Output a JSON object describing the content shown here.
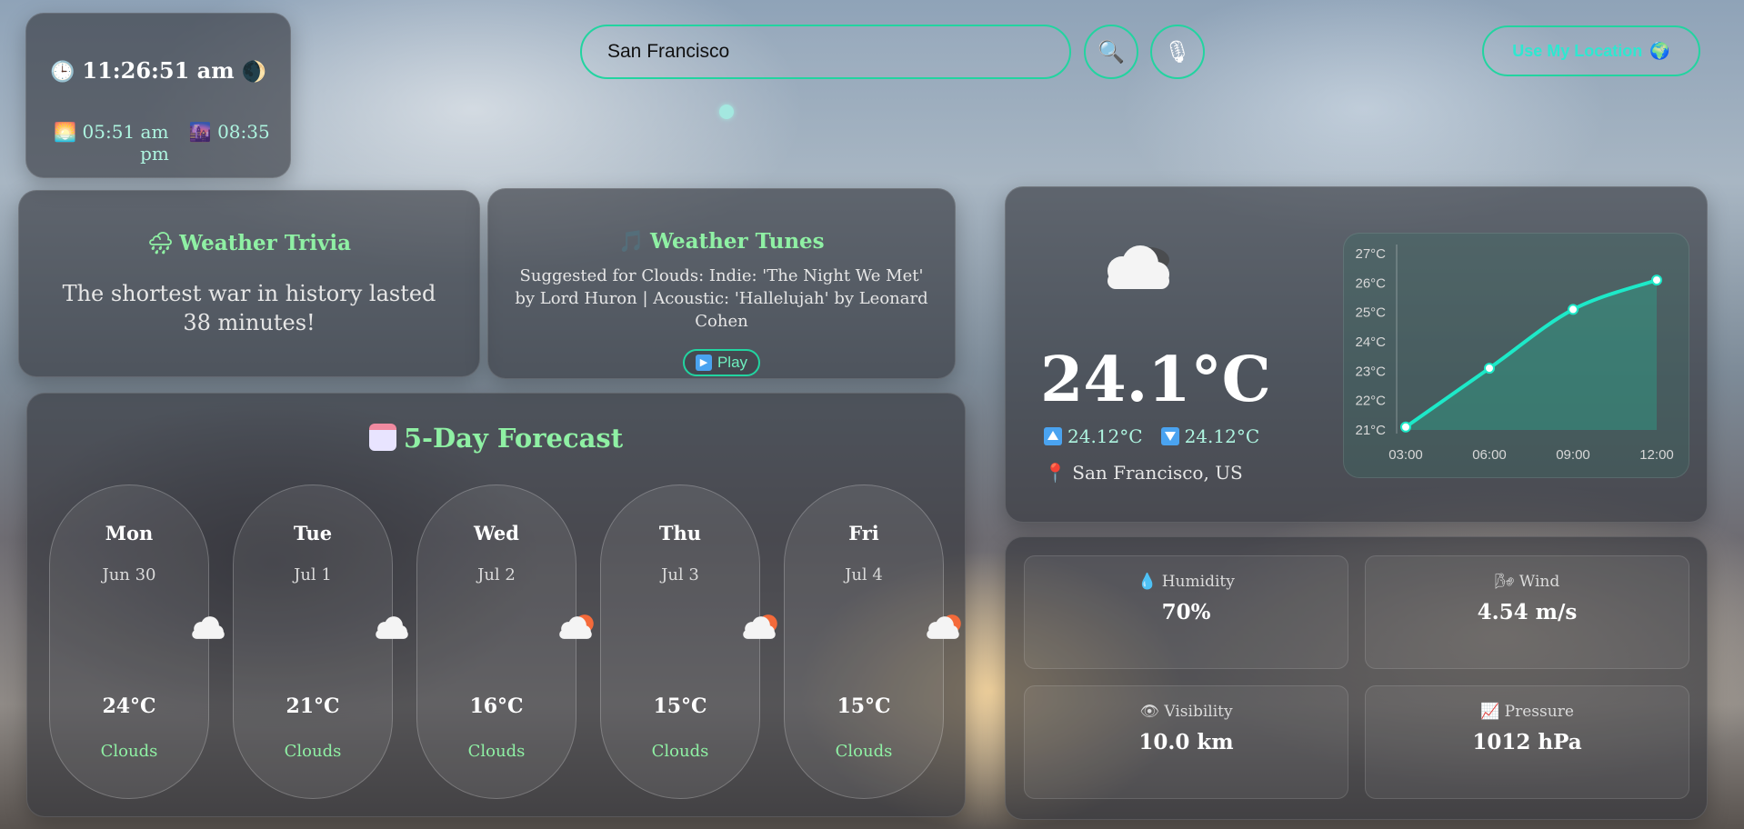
{
  "clock": {
    "time": "11:26:51 am",
    "clock_icon": "🕒",
    "moon_icon": "🌒",
    "sunrise": "05:51 am",
    "sunset": "08:35 pm",
    "sunrise_icon": "🌅",
    "sunset_icon": "🌆"
  },
  "search": {
    "value": "San Francisco",
    "search_icon": "🔍",
    "mic_icon": "🎙",
    "location_label": "Use My Location",
    "location_icon": "🌍"
  },
  "trivia": {
    "icon": "🌧",
    "title": "Weather Trivia",
    "fact": "The shortest war in history lasted 38 minutes!"
  },
  "tunes": {
    "icon": "🎵",
    "title": "Weather Tunes",
    "suggestion": "Suggested for Clouds: Indie: 'The Night We Met' by Lord Huron | Acoustic: 'Hallelujah' by Leonard Cohen",
    "play_label": "Play",
    "play_icon": "▶"
  },
  "forecast": {
    "title": "5-Day Forecast",
    "days": [
      {
        "day": "Mon",
        "date": "Jun 30",
        "temp": "24°C",
        "desc": "Clouds",
        "icon": "cloud"
      },
      {
        "day": "Tue",
        "date": "Jul 1",
        "temp": "21°C",
        "desc": "Clouds",
        "icon": "cloud"
      },
      {
        "day": "Wed",
        "date": "Jul 2",
        "temp": "16°C",
        "desc": "Clouds",
        "icon": "cloud-sun"
      },
      {
        "day": "Thu",
        "date": "Jul 3",
        "temp": "15°C",
        "desc": "Clouds",
        "icon": "cloud-sun"
      },
      {
        "day": "Fri",
        "date": "Jul 4",
        "temp": "15°C",
        "desc": "Clouds",
        "icon": "cloud-sun"
      }
    ]
  },
  "current": {
    "temp": "24.1°C",
    "high": "24.12°C",
    "low": "24.12°C",
    "location": "San Francisco, US",
    "location_icon": "📍",
    "icon": "cloud"
  },
  "stats": {
    "humidity": {
      "label": "Humidity",
      "value": "70%",
      "icon": "💧"
    },
    "wind": {
      "label": "Wind",
      "value": "4.54 m/s",
      "icon": "🌬"
    },
    "visibility": {
      "label": "Visibility",
      "value": "10.0 km",
      "icon": "👁"
    },
    "pressure": {
      "label": "Pressure",
      "value": "1012 hPa",
      "icon": "📈"
    }
  },
  "colors": {
    "accent_green": "#8ff0a4",
    "accent_teal": "#22d4a0",
    "chart_line": "#1de9c8"
  },
  "chart_data": {
    "type": "area",
    "categories": [
      "03:00",
      "06:00",
      "09:00",
      "12:00"
    ],
    "values": [
      21.1,
      23.1,
      25.1,
      26.1
    ],
    "ylim": [
      21,
      27
    ],
    "yticks": [
      "21°C",
      "22°C",
      "23°C",
      "24°C",
      "25°C",
      "26°C",
      "27°C"
    ],
    "xlabel": "",
    "ylabel": ""
  }
}
